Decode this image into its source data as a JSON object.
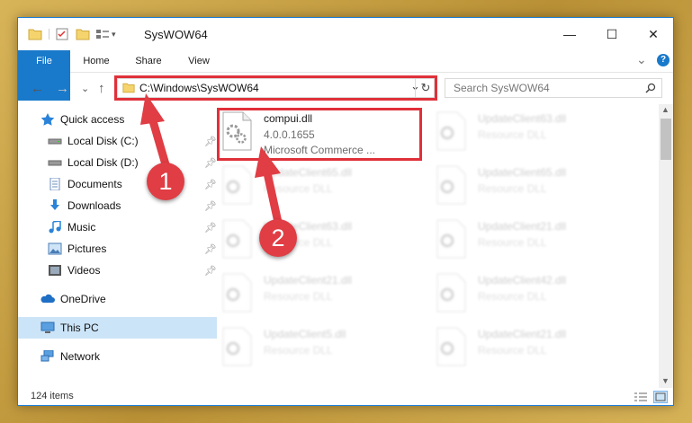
{
  "window": {
    "title": "SysWOW64",
    "minimize": "—",
    "maximize": "☐",
    "close": "✕"
  },
  "ribbon": {
    "tabs": [
      "File",
      "Home",
      "Share",
      "View"
    ],
    "help": "?",
    "expand": "⌄"
  },
  "address": {
    "path": "C:\\Windows\\SysWOW64",
    "refresh": "↻",
    "dropdown": "⌄"
  },
  "search": {
    "placeholder": "Search SysWOW64"
  },
  "nav_buttons": {
    "back": "←",
    "forward": "→",
    "recent": "⌄",
    "up": "↑"
  },
  "sidebar": {
    "quick_access": "Quick access",
    "items": [
      {
        "label": "Local Disk (C:)",
        "icon": "drive-icon"
      },
      {
        "label": "Local Disk (D:)",
        "icon": "drive-icon"
      },
      {
        "label": "Documents",
        "icon": "documents-icon"
      },
      {
        "label": "Downloads",
        "icon": "downloads-icon"
      },
      {
        "label": "Music",
        "icon": "music-icon"
      },
      {
        "label": "Pictures",
        "icon": "pictures-icon"
      },
      {
        "label": "Videos",
        "icon": "videos-icon"
      }
    ],
    "onedrive": "OneDrive",
    "this_pc": "This PC",
    "network": "Network"
  },
  "files": {
    "selected": {
      "name": "compui.dll",
      "version": "4.0.0.1655",
      "description": "Microsoft Commerce ..."
    },
    "faded": [
      {
        "name": "UpdateClient63.dll",
        "type": "Resource DLL"
      },
      {
        "name": "UpdateClient65.dll",
        "type": "Resource DLL"
      },
      {
        "name": "UpdateClient65.dll",
        "type": "Resource DLL"
      },
      {
        "name": "UpdateClient63.dll",
        "type": "Resource DLL"
      },
      {
        "name": "UpdateClient21.dll",
        "type": "Resource DLL"
      },
      {
        "name": "UpdateClient21.dll",
        "type": "Resource DLL"
      },
      {
        "name": "UpdateClient42.dll",
        "type": "Resource DLL"
      },
      {
        "name": "UpdateClient5.dll",
        "type": "Resource DLL"
      },
      {
        "name": "UpdateClient21.dll",
        "type": "Resource DLL"
      }
    ]
  },
  "status": {
    "count": "124 items"
  },
  "annotations": {
    "badge1": "1",
    "badge2": "2",
    "color": "#e03d44"
  }
}
